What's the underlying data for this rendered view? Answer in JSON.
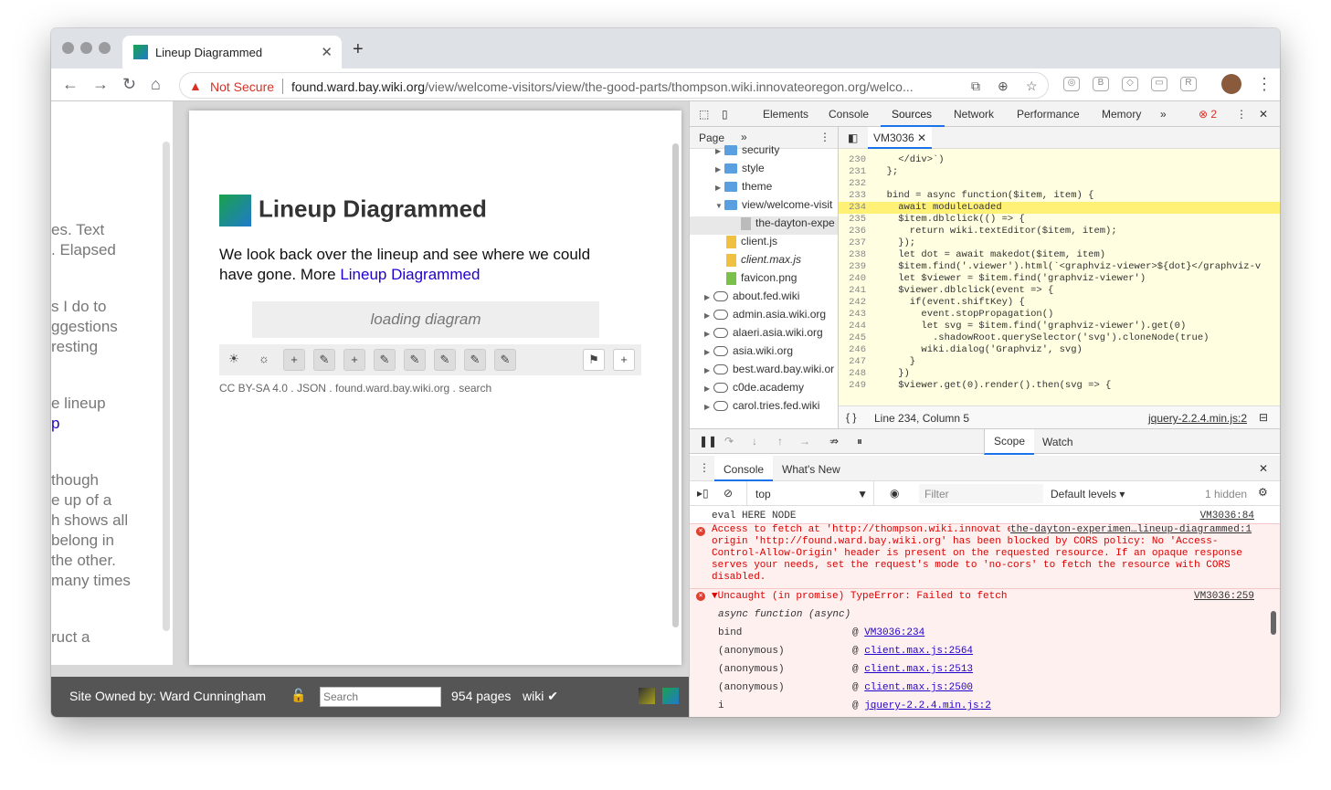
{
  "tab": {
    "title": "Lineup Diagrammed"
  },
  "address": {
    "security": "Not Secure",
    "host": "found.ward.bay.wiki.org",
    "path": "/view/welcome-visitors/view/the-good-parts/thompson.wiki.innovateoregon.org/welco..."
  },
  "left": {
    "lines": [
      "es. Text",
      ". Elapsed",
      "s I do to",
      "ggestions",
      "resting",
      "e lineup",
      "p",
      "though",
      "e up of a",
      "h shows all",
      "belong in",
      "the other.",
      "many times",
      "ruct a"
    ]
  },
  "page": {
    "title": "Lineup Diagrammed",
    "text": "We look back over the lineup and see where we could have gone. More ",
    "link": "Lineup Diagrammed",
    "loading": "loading diagram",
    "footer": {
      "license": "CC BY-SA 4.0",
      "json": "JSON",
      "site": "found.ward.bay.wiki.org",
      "search": "search"
    }
  },
  "status": {
    "owner": "Site Owned by: Ward Cunningham",
    "search_placeholder": "Search",
    "pages": "954 pages",
    "wiki": "wiki ✔"
  },
  "devtools": {
    "tabs": [
      "Elements",
      "Console",
      "Sources",
      "Network",
      "Performance",
      "Memory"
    ],
    "active_tab": "Sources",
    "errors": "2",
    "nav_header": "Page",
    "tree": [
      "security",
      "style",
      "theme",
      "view/welcome-visit",
      "the-dayton-expe",
      "client.js",
      "client.max.js",
      "favicon.png",
      "about.fed.wiki",
      "admin.asia.wiki.org",
      "alaeri.asia.wiki.org",
      "asia.wiki.org",
      "best.ward.bay.wiki.or",
      "c0de.academy",
      "carol.tries.fed.wiki"
    ],
    "file_tab": "VM3036",
    "code": [
      {
        "n": "230",
        "t": "    </div>`)"
      },
      {
        "n": "231",
        "t": "  };"
      },
      {
        "n": "232",
        "t": ""
      },
      {
        "n": "233",
        "t": "  bind = async function($item, item) {"
      },
      {
        "n": "234",
        "t": "    await moduleLoaded"
      },
      {
        "n": "235",
        "t": "    $item.dblclick(() => {"
      },
      {
        "n": "236",
        "t": "      return wiki.textEditor($item, item);"
      },
      {
        "n": "237",
        "t": "    });"
      },
      {
        "n": "238",
        "t": "    let dot = await makedot($item, item)"
      },
      {
        "n": "239",
        "t": "    $item.find('.viewer').html(`<graphviz-viewer>${dot}</graphviz-v"
      },
      {
        "n": "240",
        "t": "    let $viewer = $item.find('graphviz-viewer')"
      },
      {
        "n": "241",
        "t": "    $viewer.dblclick(event => {"
      },
      {
        "n": "242",
        "t": "      if(event.shiftKey) {"
      },
      {
        "n": "243",
        "t": "        event.stopPropagation()"
      },
      {
        "n": "244",
        "t": "        let svg = $item.find('graphviz-viewer').get(0)"
      },
      {
        "n": "245",
        "t": "          .shadowRoot.querySelector('svg').cloneNode(true)"
      },
      {
        "n": "246",
        "t": "        wiki.dialog('Graphviz', svg)"
      },
      {
        "n": "247",
        "t": "      }"
      },
      {
        "n": "248",
        "t": "    })"
      },
      {
        "n": "249",
        "t": "    $viewer.get(0).render().then(svg => {"
      }
    ],
    "position": "Line 234, Column 5",
    "source_link": "jquery-2.2.4.min.js:2",
    "scope": "Scope",
    "watch": "Watch",
    "drawer_tabs": [
      "Console",
      "What's New"
    ],
    "context": "top",
    "filter": "Filter",
    "levels": "Default levels ▾",
    "hidden": "1 hidden",
    "messages": {
      "log": "eval HERE NODE",
      "log_src": "VM3036:84",
      "cors": "Access to fetch at 'http://thompson.wiki.innovat eoregon.org/welcome-visitors.json' from origin 'http://found.ward.bay.wiki.org' has been blocked by CORS policy: No 'Access-Control-Allow-Origin' header is present on the requested resource. If an opaque response serves your needs, set the request's mode to 'no-cors' to fetch the resource with CORS disabled.",
      "cors_src": "the-dayton-experimen…lineup-diagrammed:1",
      "uncaught": "▼Uncaught (in promise) TypeError: Failed to fetch",
      "uncaught_src": "VM3036:259",
      "async": "async function (async)",
      "stack": [
        {
          "fn": "bind",
          "loc": "VM3036:234"
        },
        {
          "fn": "(anonymous)",
          "loc": "client.max.js:2564"
        },
        {
          "fn": "(anonymous)",
          "loc": "client.max.js:2513"
        },
        {
          "fn": "(anonymous)",
          "loc": "client.max.js:2500"
        },
        {
          "fn": "i",
          "loc": "jquery-2.2.4.min.js:2"
        }
      ]
    }
  }
}
